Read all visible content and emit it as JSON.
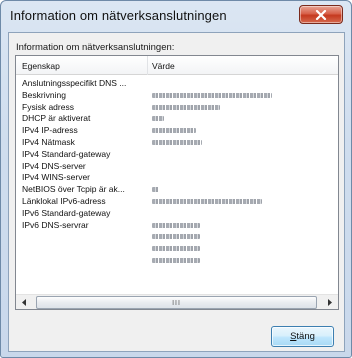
{
  "window": {
    "title": "Information om nätverksanslutningen",
    "close_icon": "close-x-icon"
  },
  "section_label": "Information om nätverksanslutningen:",
  "list": {
    "columns": [
      "Egenskap",
      "Värde"
    ],
    "rows": [
      {
        "property": "Anslutningsspecifikt DNS ...",
        "value_width": 0
      },
      {
        "property": "Beskrivning",
        "value_width": 120
      },
      {
        "property": "Fysisk adress",
        "value_width": 68
      },
      {
        "property": "DHCP är aktiverat",
        "value_width": 12
      },
      {
        "property": "IPv4 IP-adress",
        "value_width": 44
      },
      {
        "property": "IPv4 Nätmask",
        "value_width": 50
      },
      {
        "property": "IPv4 Standard-gateway",
        "value_width": 0
      },
      {
        "property": "IPv4 DNS-server",
        "value_width": 0
      },
      {
        "property": "IPv4 WINS-server",
        "value_width": 0
      },
      {
        "property": "NetBIOS över Tcpip är ak...",
        "value_width": 7
      },
      {
        "property": "Länklokal IPv6-adress",
        "value_width": 110
      },
      {
        "property": "IPv6 Standard-gateway",
        "value_width": 0
      },
      {
        "property": "IPv6 DNS-servrar",
        "value_width": 48
      },
      {
        "property": "",
        "value_width": 48
      },
      {
        "property": "",
        "value_width": 48
      },
      {
        "property": "",
        "value_width": 48
      }
    ]
  },
  "scrollbar": {
    "left_icon": "scroll-left-arrow-icon",
    "right_icon": "scroll-right-arrow-icon",
    "grip": "III"
  },
  "close_button": {
    "accel": "S",
    "rest": "täng"
  },
  "colors": {
    "titlebar": "#cfddee",
    "close_red": "#c5391f",
    "button_blue": "#bee6fd"
  }
}
